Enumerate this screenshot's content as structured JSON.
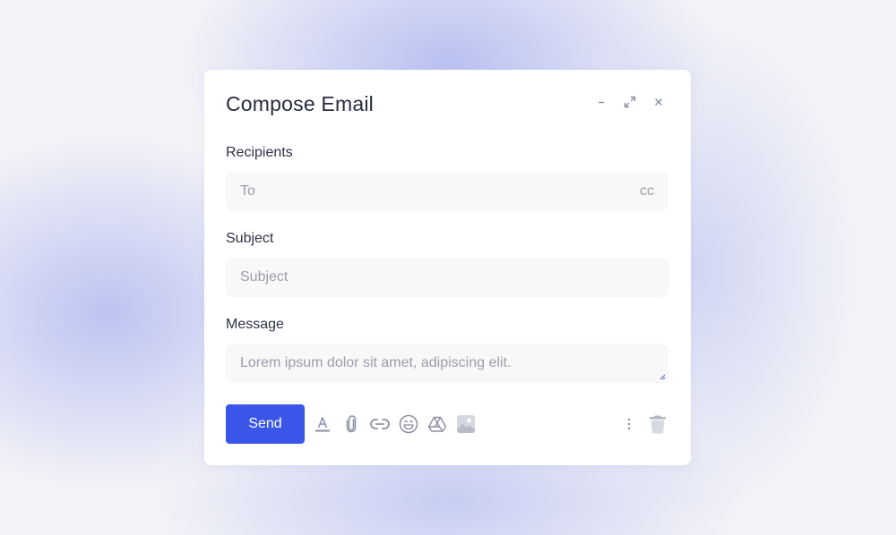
{
  "modal": {
    "title": "Compose Email",
    "window_controls": [
      "minimize-icon",
      "expand-icon",
      "close-icon"
    ]
  },
  "recipients": {
    "label": "Recipients",
    "placeholder": "To",
    "cc_label": "cc"
  },
  "subject": {
    "label": "Subject",
    "placeholder": "Subject"
  },
  "message": {
    "label": "Message",
    "placeholder": "Lorem ipsum dolor sit amet, adipiscing elit."
  },
  "toolbar": {
    "send_label": "Send",
    "tools": [
      "text-format-icon",
      "attachment-icon",
      "link-icon",
      "emoji-icon",
      "drive-icon",
      "image-icon"
    ],
    "more_options": "more-vertical-icon",
    "delete": "trash-icon"
  },
  "colors": {
    "accent": "#3a56e8",
    "icon": "#8a8ea0",
    "field_bg": "#f8f8f9",
    "text": "#262b3f"
  }
}
